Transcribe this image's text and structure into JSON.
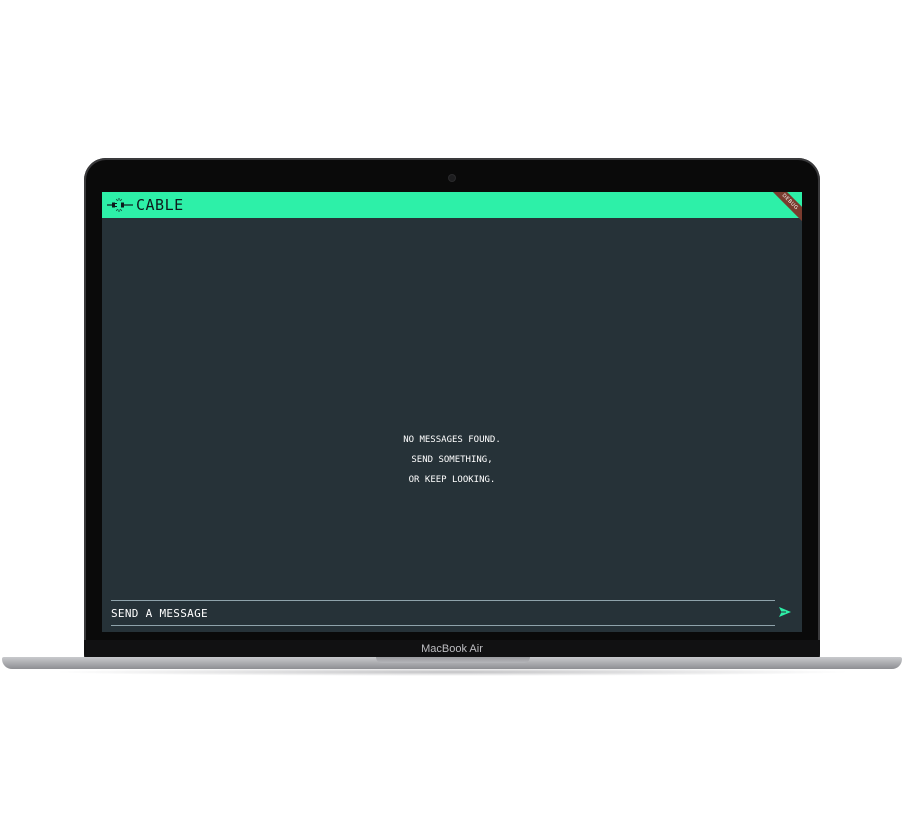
{
  "device": {
    "model_label": "MacBook Air"
  },
  "app": {
    "title": "CABLE",
    "logo_icon": "plug-cable-icon",
    "debug_banner": "DEBUG"
  },
  "chat": {
    "empty_state": {
      "lines": [
        "NO MESSAGES FOUND.",
        "SEND SOMETHING,",
        "OR KEEP LOOKING."
      ]
    },
    "composer": {
      "placeholder": "SEND A MESSAGE",
      "value": "",
      "send_icon": "send-arrow-icon"
    }
  },
  "colors": {
    "appbar": "#2df0a8",
    "background": "#263238",
    "text": "#ffffff",
    "send": "#2df0a8"
  }
}
